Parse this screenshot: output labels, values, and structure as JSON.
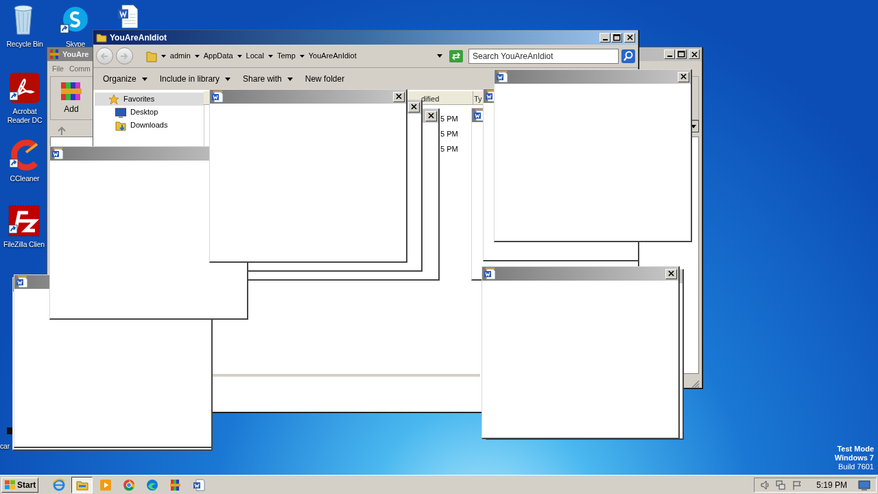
{
  "desktop_icons": [
    {
      "label": "Recycle Bin",
      "kind": "recycle"
    },
    {
      "label": "Skype",
      "kind": "skype"
    },
    {
      "kind": "document"
    },
    {
      "label": "Acrobat Reader DC",
      "kind": "acrobat"
    },
    {
      "label": "CCleaner",
      "kind": "ccleaner"
    },
    {
      "label": "FileZilla Clien",
      "kind": "filezilla"
    },
    {
      "label": "car",
      "kind": "dark"
    }
  ],
  "back_window": {
    "title": "YouAre",
    "menu": [
      "File",
      "Comm"
    ],
    "toolbar": [
      "Add"
    ]
  },
  "explorer": {
    "title": "YouAreAnIdiot",
    "breadcrumb": [
      "admin",
      "AppData",
      "Local",
      "Temp",
      "YouAreAnIdiot"
    ],
    "search": {
      "placeholder": "Search YouAreAnIdiot"
    },
    "toolbar": [
      {
        "label": "Organize",
        "dropdown": true
      },
      {
        "label": "Include in library",
        "dropdown": true
      },
      {
        "label": "Share with",
        "dropdown": true
      },
      {
        "label": "New folder",
        "dropdown": false
      }
    ],
    "nav": [
      {
        "label": "Favorites",
        "kind": "group",
        "selected": true
      },
      {
        "label": "Desktop",
        "kind": "desktop",
        "selected": false
      },
      {
        "label": "Downloads",
        "kind": "downloads",
        "selected": false
      }
    ],
    "columns": [
      "dified",
      "Ty"
    ],
    "rows": [
      "5 PM",
      "5 PM",
      "5 PM"
    ]
  },
  "desktop_text": [
    "Test Mode",
    "Windows 7",
    "Build 7601"
  ],
  "taskbar": {
    "start": "Start",
    "apps": [
      {
        "kind": "ie",
        "selected": false
      },
      {
        "kind": "explorer",
        "selected": true
      },
      {
        "kind": "media",
        "selected": false
      },
      {
        "kind": "chrome",
        "selected": false
      },
      {
        "kind": "edge",
        "selected": false
      },
      {
        "kind": "winrar",
        "selected": false
      },
      {
        "kind": "word",
        "selected": false
      }
    ],
    "clock": "5:19 PM"
  }
}
